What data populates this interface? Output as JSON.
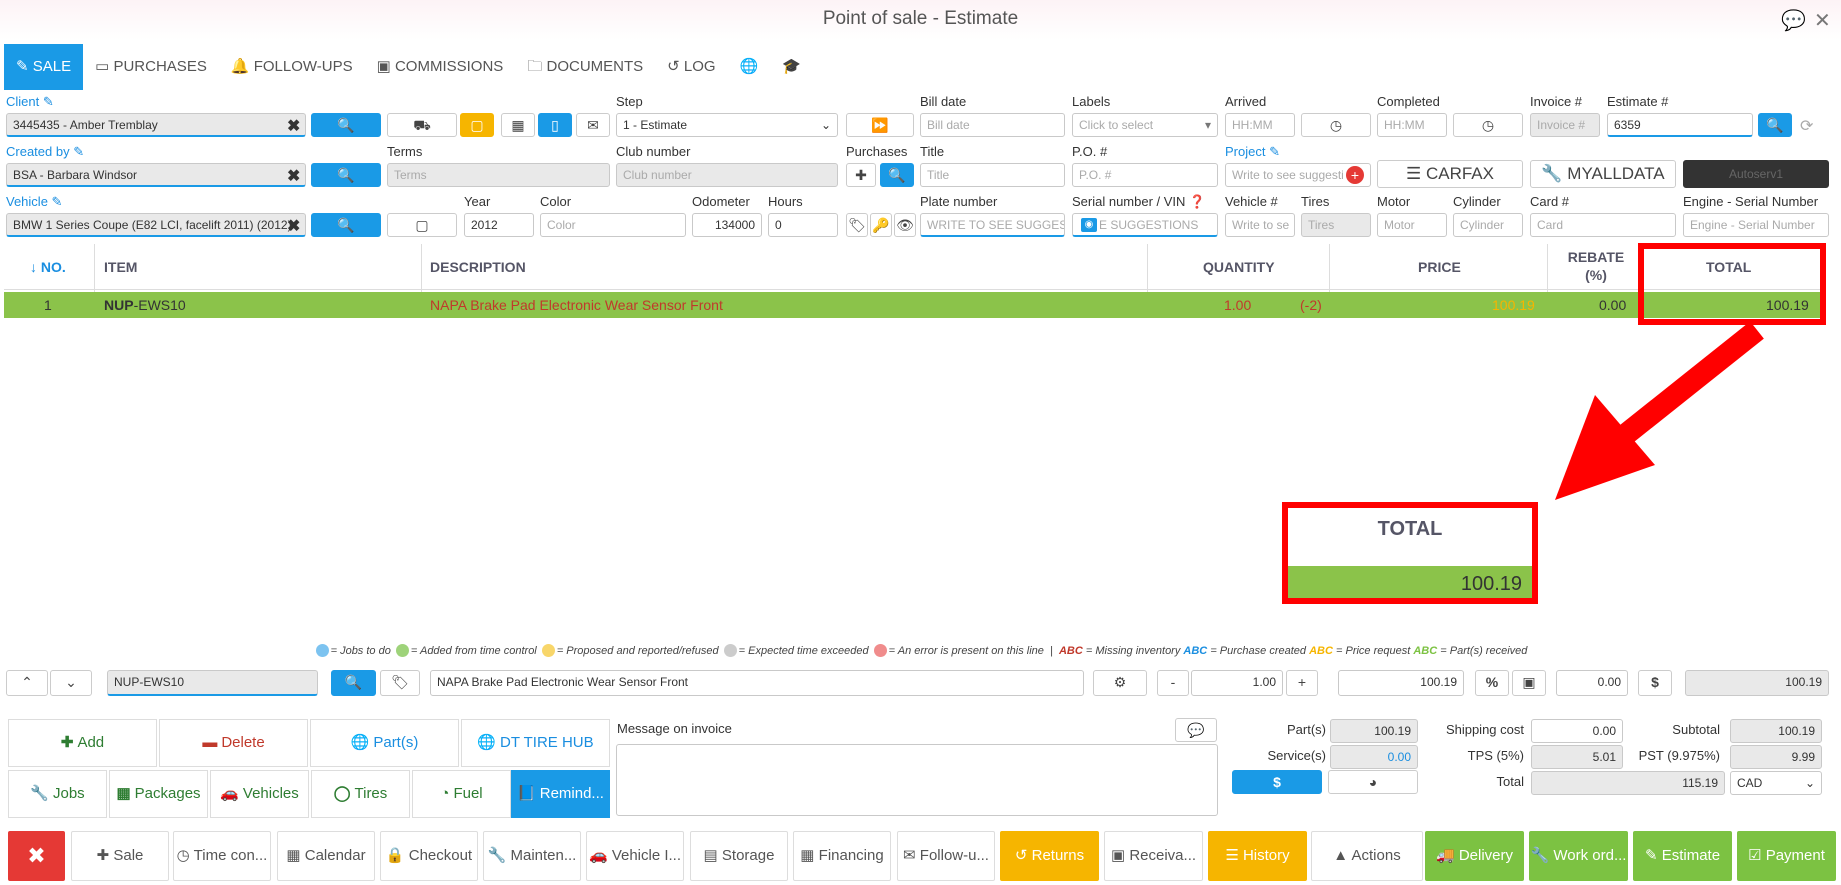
{
  "window": {
    "title": "Point of sale - Estimate"
  },
  "tabs": [
    {
      "icon": "✎",
      "label": "SALE"
    },
    {
      "icon": "▭",
      "label": "PURCHASES"
    },
    {
      "icon": "🔔",
      "label": "FOLLOW-UPS"
    },
    {
      "icon": "▣",
      "label": "COMMISSIONS"
    },
    {
      "icon": "🗀",
      "label": "DOCUMENTS"
    },
    {
      "icon": "↺",
      "label": "LOG"
    }
  ],
  "form": {
    "client_label": "Client",
    "client_value": "3445435 - Amber Tremblay",
    "step_label": "Step",
    "step_value": "1 - Estimate",
    "bill_date_label": "Bill date",
    "bill_date_ph": "Bill date",
    "labels_label": "Labels",
    "labels_ph": "Click to select",
    "arrived_label": "Arrived",
    "arrived_ph": "HH:MM",
    "completed_label": "Completed",
    "completed_ph": "HH:MM",
    "invoice_label": "Invoice #",
    "invoice_ph": "Invoice #",
    "estimate_label": "Estimate #",
    "estimate_value": "6359",
    "created_by_label": "Created by",
    "created_by_value": "BSA - Barbara Windsor",
    "terms_label": "Terms",
    "terms_ph": "Terms",
    "club_label": "Club number",
    "club_ph": "Club number",
    "purchases_label": "Purchases",
    "title_label": "Title",
    "title_ph": "Title",
    "po_label": "P.O. #",
    "po_ph": "P.O. #",
    "project_label": "Project",
    "project_ph": "Write to see suggesti",
    "carfax": "CARFAX",
    "myalldata": "MYALLDATA",
    "autoserv": "Autoserv1",
    "vehicle_label": "Vehicle",
    "vehicle_value": "BMW 1 Series Coupe (E82 LCI, facelift 2011) (2012)",
    "year_label": "Year",
    "year_value": "2012",
    "color_label": "Color",
    "color_ph": "Color",
    "odometer_label": "Odometer",
    "odometer_value": "134000",
    "hours_label": "Hours",
    "hours_value": "0",
    "plate_label": "Plate number",
    "plate_ph": "WRITE TO SEE SUGGEST",
    "serial_label": "Serial number / VIN",
    "serial_ph": "E SUGGESTIONS",
    "vehicleno_label": "Vehicle #",
    "vehicleno_ph": "Write to se",
    "tires_label": "Tires",
    "tires_ph": "Tires",
    "motor_label": "Motor",
    "motor_ph": "Motor",
    "cylinder_label": "Cylinder",
    "cylinder_ph": "Cylinder",
    "card_label": "Card #",
    "card_ph": "Card",
    "engine_label": "Engine - Serial Number",
    "engine_ph": "Engine - Serial Number"
  },
  "table": {
    "headers": {
      "no": "↓ NO.",
      "item": "ITEM",
      "description": "DESCRIPTION",
      "quantity": "QUANTITY",
      "price": "PRICE",
      "rebate": "REBATE",
      "rebate_unit": "(%)",
      "total": "TOTAL"
    },
    "rows": [
      {
        "no": "1",
        "item_prefix": "NUP",
        "item_rest": "-EWS10",
        "description": "NAPA Brake Pad Electronic Wear Sensor Front",
        "quantity": "1.00",
        "qty_delta": "(-2)",
        "price": "100.19",
        "rebate": "0.00",
        "total": "100.19"
      }
    ]
  },
  "zoom": {
    "label": "TOTAL",
    "value": "100.19"
  },
  "legend": {
    "jobs": "= Jobs to do",
    "added": "= Added from time control",
    "proposed": "= Proposed and reported/refused",
    "expected": "= Expected time exceeded",
    "error": "= An error is present on this line",
    "sep": "|",
    "abc": "ABC",
    "missing": "= Missing inventory",
    "purchase": "= Purchase created",
    "price_req": "= Price request",
    "received": "= Part(s) received"
  },
  "editor": {
    "item": "NUP-EWS10",
    "description": "NAPA Brake Pad Electronic Wear Sensor Front",
    "minus": "-",
    "qty": "1.00",
    "plus": "+",
    "price": "100.19",
    "pct": "%",
    "rebate": "0.00",
    "dollar": "$",
    "total": "100.19"
  },
  "actions": {
    "add": "Add",
    "delete": "Delete",
    "parts": "Part(s)",
    "dt_tire": "DT TIRE HUB",
    "jobs": "Jobs",
    "packages": "Packages",
    "vehicles": "Vehicles",
    "tires": "Tires",
    "fuel": "Fuel",
    "remind": "Remind..."
  },
  "message": {
    "label": "Message on invoice"
  },
  "summary": {
    "parts_label": "Part(s)",
    "parts": "100.19",
    "services_label": "Service(s)",
    "services": "0.00",
    "dollar": "$",
    "shipping_label": "Shipping cost",
    "shipping": "0.00",
    "tps_label": "TPS (5%)",
    "tps": "5.01",
    "total_label": "Total",
    "total": "115.19",
    "subtotal_label": "Subtotal",
    "subtotal": "100.19",
    "pst_label": "PST (9.975%)",
    "pst": "9.99",
    "currency": "CAD"
  },
  "bottom": {
    "close": "✖",
    "sale": "Sale",
    "time": "Time con...",
    "calendar": "Calendar",
    "checkout": "Checkout",
    "maintenance": "Mainten...",
    "vehicle": "Vehicle I...",
    "storage": "Storage",
    "financing": "Financing",
    "followup": "Follow-u...",
    "returns": "Returns",
    "receivables": "Receiva...",
    "history": "History",
    "actions": "Actions",
    "delivery": "Delivery",
    "workorder": "Work ord...",
    "estimate": "Estimate",
    "payment": "Payment"
  },
  "colors": {
    "accent": "#1a9ae6",
    "row_green": "#8bc34a",
    "highlight_red": "#ff0000",
    "warning_yellow": "#f6b500",
    "action_green": "#7cc242"
  }
}
